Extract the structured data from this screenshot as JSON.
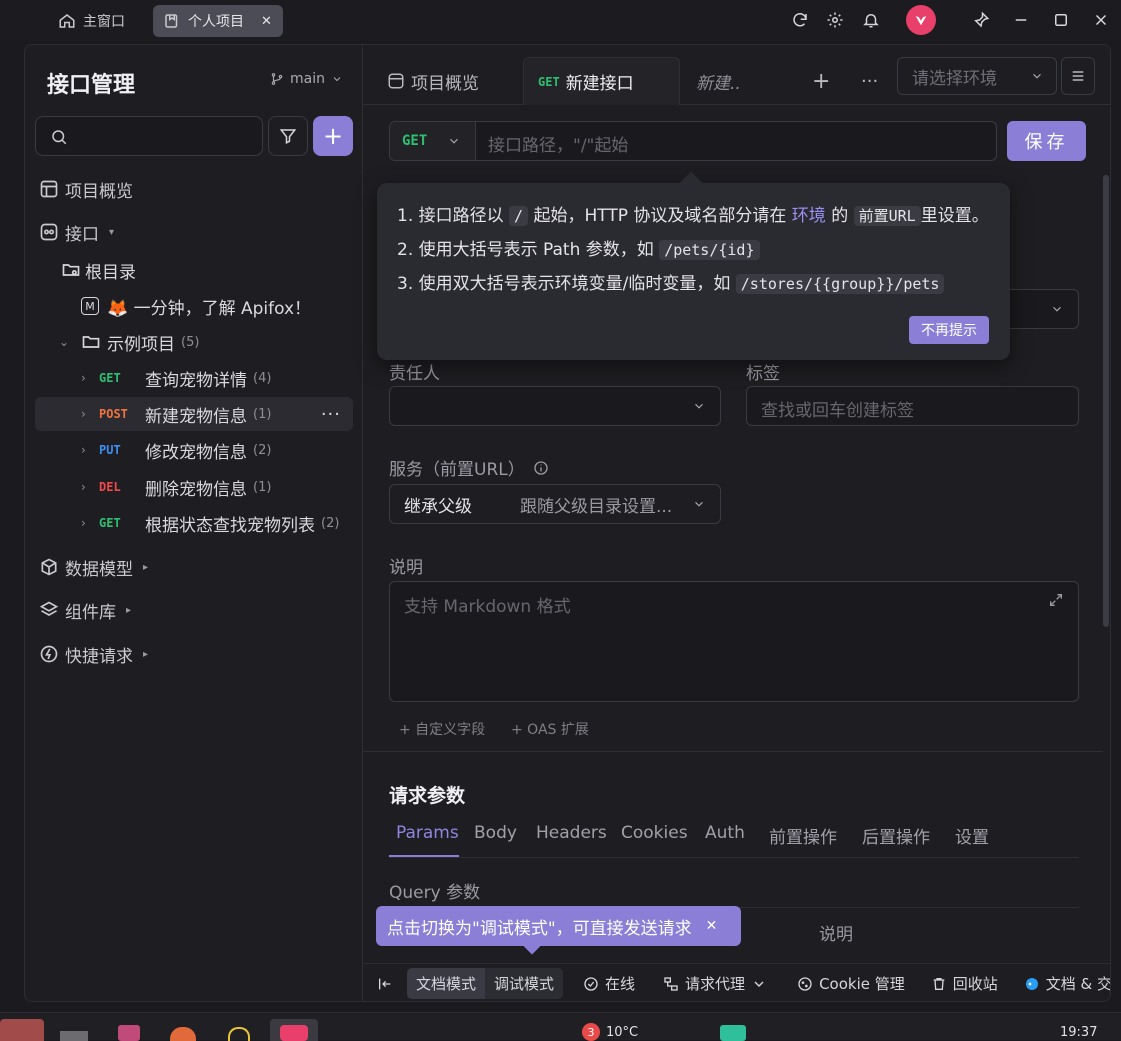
{
  "titlebar": {
    "home_tab": "主窗口",
    "project_tab": "个人项目",
    "close_glyph": "✕"
  },
  "sidebar": {
    "title": "接口管理",
    "branch": "main",
    "nav": {
      "overview": "项目概览",
      "apis": "接口",
      "data_models": "数据模型",
      "components": "组件库",
      "quick_requests": "快捷请求"
    },
    "tree": {
      "root": "根目录",
      "doc": "🦊 一分钟，了解 Apifox！",
      "folder": "示例项目",
      "folder_count": "(5)",
      "items": [
        {
          "method": "GET",
          "name": "查询宠物详情",
          "count": "(4)",
          "color": "#2fbf71"
        },
        {
          "method": "POST",
          "name": "新建宠物信息",
          "count": "(1)",
          "color": "#f0743e"
        },
        {
          "method": "PUT",
          "name": "修改宠物信息",
          "count": "(2)",
          "color": "#3d8ef0"
        },
        {
          "method": "DEL",
          "name": "删除宠物信息",
          "count": "(1)",
          "color": "#f04a4a"
        },
        {
          "method": "GET",
          "name": "根据状态查找宠物列表",
          "count": "(2)",
          "color": "#2fbf71"
        }
      ]
    }
  },
  "main": {
    "tabs": {
      "overview": "项目概览",
      "new_method": "GET",
      "new_label": "新建接口",
      "new_italic": "新建..",
      "env_placeholder": "请选择环境"
    },
    "url": {
      "method": "GET",
      "placeholder": "接口路径，\"/\"起始",
      "save": "保存"
    },
    "tooltip": {
      "line1_a": "1. 接口路径以",
      "line1_code1": "/",
      "line1_b": "起始，HTTP 协议及域名部分请在",
      "line1_link": "环境",
      "line1_c": "的",
      "line1_code2": "前置URL",
      "line1_d": "里设置。",
      "line2_a": "2. 使用大括号表示 Path 参数，如",
      "line2_code": "/pets/{id}",
      "line3_a": "3. 使用双大括号表示环境变量/临时变量，如",
      "line3_code": "/stores/{{group}}/pets",
      "dismiss": "不再提示"
    },
    "form": {
      "owner_label": "责任人",
      "tags_label": "标签",
      "tags_placeholder": "查找或回车创建标签",
      "service_label": "服务（前置URL）",
      "service_value": "继承父级",
      "service_hint": "跟随父级目录设置...",
      "desc_label": "说明",
      "desc_placeholder": "支持 Markdown 格式",
      "custom_field": "+ 自定义字段",
      "oas_ext": "+ OAS 扩展"
    },
    "params": {
      "title": "请求参数",
      "tabs": [
        "Params",
        "Body",
        "Headers",
        "Cookies",
        "Auth",
        "前置操作",
        "后置操作",
        "设置"
      ],
      "query_label": "Query 参数",
      "col_desc": "说明"
    },
    "debug_tip": "点击切换为\"调试模式\"，可直接发送请求",
    "bottombar": {
      "doc_mode": "文档模式",
      "debug_mode": "调试模式",
      "online": "在线",
      "proxy": "请求代理",
      "cookie": "Cookie 管理",
      "trash": "回收站",
      "docs": "文档 & 交"
    }
  },
  "taskbar": {
    "badge": "3",
    "weather": "10°C",
    "time": "19:37"
  }
}
